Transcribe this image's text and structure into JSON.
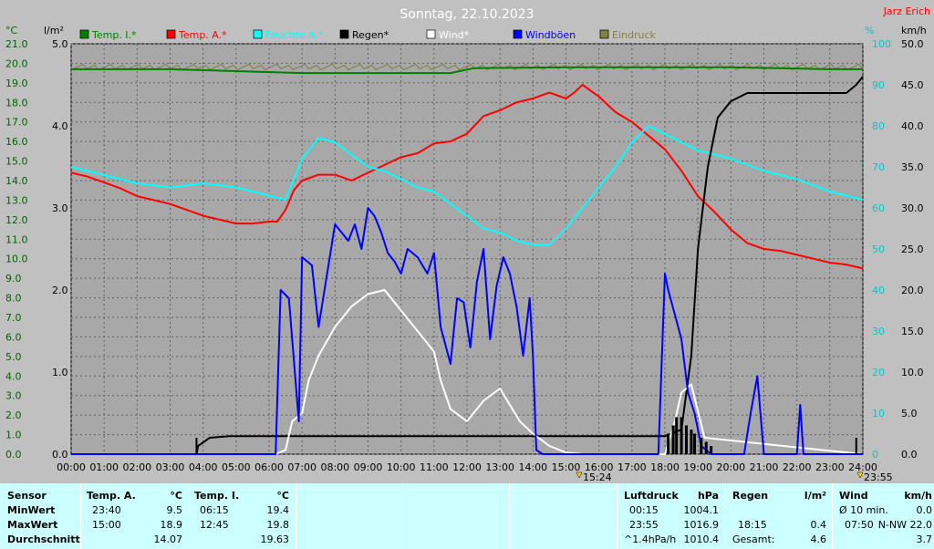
{
  "chart_data": {
    "type": "line",
    "title": "Sonntag, 22.10.2023",
    "author": "Jarz Erich",
    "left_axis_temp": {
      "unit": "°C",
      "ylim": [
        0.0,
        21.0
      ],
      "ticks": [
        "0.0",
        "1.0",
        "2.0",
        "3.0",
        "4.0",
        "5.0",
        "6.0",
        "7.0",
        "8.0",
        "9.0",
        "10.0",
        "11.0",
        "12.0",
        "13.0",
        "14.0",
        "15.0",
        "16.0",
        "17.0",
        "18.0",
        "19.0",
        "20.0",
        "21.0"
      ]
    },
    "left_axis_rain": {
      "unit": "l/m²",
      "ylim": [
        0.0,
        5.0
      ],
      "ticks": [
        "0.0",
        "1.0",
        "2.0",
        "3.0",
        "4.0",
        "5.0"
      ]
    },
    "right_axis_humidity": {
      "unit": "%",
      "ylim": [
        0,
        100
      ],
      "ticks": [
        "0",
        "10",
        "20",
        "30",
        "40",
        "50",
        "60",
        "70",
        "80",
        "90",
        "100"
      ]
    },
    "right_axis_wind": {
      "unit": "km/h",
      "ylim": [
        0.0,
        50.0
      ],
      "ticks": [
        "0.0",
        "5.0",
        "10.0",
        "15.0",
        "20.0",
        "25.0",
        "30.0",
        "35.0",
        "40.0",
        "45.0",
        "50.0"
      ]
    },
    "x_ticks": [
      "00:00",
      "01:00",
      "02:00",
      "03:00",
      "04:00",
      "05:00",
      "06:00",
      "07:00",
      "08:00",
      "09:00",
      "10:00",
      "11:00",
      "12:00",
      "13:00",
      "14:00",
      "15:00",
      "16:00",
      "17:00",
      "18:00",
      "19:00",
      "20:00",
      "21:00",
      "22:00",
      "23:00",
      "24:00"
    ],
    "x_markers": [
      "15:24",
      "23:55"
    ],
    "legend": [
      {
        "name": "Temp. I.*",
        "color": "#008000"
      },
      {
        "name": "Temp. A.*",
        "color": "#ff0000"
      },
      {
        "name": "Feuchte A.*",
        "color": "#00ffff"
      },
      {
        "name": "Regen*",
        "color": "#000000"
      },
      {
        "name": "Wind*",
        "color": "#ffffff"
      },
      {
        "name": "Windböen",
        "color": "#0000ff"
      },
      {
        "name": "Eindruck",
        "color": "#808040"
      }
    ],
    "series": [
      {
        "name": "Temp. I.*",
        "axis": "temp",
        "color": "#008000",
        "x": [
          0,
          3,
          5,
          7,
          10,
          11.5,
          12.2,
          15,
          18,
          20,
          23,
          24
        ],
        "y": [
          19.7,
          19.7,
          19.6,
          19.5,
          19.5,
          19.5,
          19.75,
          19.8,
          19.8,
          19.8,
          19.7,
          19.7
        ]
      },
      {
        "name": "Temp. A.*",
        "axis": "temp",
        "color": "#ff0000",
        "x": [
          0,
          0.5,
          1,
          1.5,
          2,
          2.5,
          3,
          3.5,
          4,
          4.5,
          5,
          5.5,
          6,
          6.25,
          6.5,
          6.75,
          7,
          7.5,
          8,
          8.5,
          9,
          9.5,
          10,
          10.5,
          11,
          11.5,
          12,
          12.5,
          13,
          13.5,
          14,
          14.5,
          15,
          15.25,
          15.5,
          16,
          16.5,
          17,
          17.5,
          18,
          18.5,
          19,
          19.5,
          20,
          20.5,
          21,
          21.5,
          22,
          22.5,
          23,
          23.5,
          24
        ],
        "y": [
          14.4,
          14.2,
          13.9,
          13.6,
          13.2,
          13.0,
          12.8,
          12.5,
          12.2,
          12.0,
          11.8,
          11.8,
          11.9,
          11.9,
          12.5,
          13.5,
          14.0,
          14.3,
          14.3,
          14.0,
          14.4,
          14.8,
          15.2,
          15.4,
          15.9,
          16.0,
          16.4,
          17.3,
          17.6,
          18.0,
          18.2,
          18.5,
          18.2,
          18.5,
          18.9,
          18.3,
          17.5,
          17.0,
          16.3,
          15.6,
          14.5,
          13.2,
          12.4,
          11.5,
          10.8,
          10.5,
          10.4,
          10.2,
          10.0,
          9.8,
          9.7,
          9.5
        ]
      },
      {
        "name": "Feuchte A.*",
        "axis": "humidity",
        "color": "#00ffff",
        "x": [
          0,
          1,
          2,
          3,
          4,
          5,
          6,
          6.5,
          7,
          7.5,
          8,
          8.5,
          9,
          9.5,
          10,
          10.5,
          11,
          11.5,
          12,
          12.5,
          13,
          13.5,
          14,
          14.5,
          15,
          15.5,
          16,
          16.5,
          17,
          17.5,
          18,
          18.5,
          19,
          20,
          21,
          22,
          23,
          24
        ],
        "y": [
          70,
          68,
          66,
          65,
          66,
          65,
          63,
          62,
          72,
          77,
          76,
          73,
          70,
          69,
          67,
          65,
          64,
          61,
          58,
          55,
          54,
          52,
          51,
          51,
          55,
          60,
          65,
          70,
          76,
          80,
          78,
          76,
          74,
          72,
          69,
          67,
          64,
          62
        ]
      },
      {
        "name": "Regen*",
        "axis": "rain",
        "color": "#000000",
        "x": [
          0,
          3.8,
          3.85,
          4.2,
          4.8,
          5.5,
          12,
          18,
          18.5,
          18.8,
          19.0,
          19.3,
          19.6,
          20,
          20.5,
          21,
          22,
          23,
          23.5,
          23.8,
          24
        ],
        "y": [
          0.0,
          0.0,
          0.1,
          0.2,
          0.22,
          0.22,
          0.22,
          0.22,
          0.3,
          1.2,
          2.5,
          3.5,
          4.1,
          4.3,
          4.4,
          4.4,
          4.4,
          4.4,
          4.4,
          4.5,
          4.6
        ]
      },
      {
        "name": "Wind*",
        "axis": "wind",
        "color": "#ffffff",
        "x": [
          0,
          6.2,
          6.5,
          6.7,
          7,
          7.2,
          7.5,
          8,
          8.5,
          9,
          9.5,
          10,
          10.5,
          11,
          11.2,
          11.5,
          12,
          12.5,
          13,
          13.3,
          13.6,
          14,
          14.5,
          15,
          15.5,
          18,
          18.3,
          18.5,
          18.8,
          19.2,
          24
        ],
        "y": [
          0,
          0,
          0.5,
          4.0,
          5.0,
          9.0,
          12.0,
          15.5,
          18.0,
          19.5,
          20.0,
          17.5,
          15.0,
          12.5,
          9.0,
          5.5,
          4.0,
          6.5,
          8.0,
          6.0,
          4.0,
          2.5,
          1.0,
          0.2,
          0,
          0,
          4.0,
          7.5,
          8.5,
          2.0,
          0
        ]
      },
      {
        "name": "Windböen",
        "axis": "wind",
        "color": "#0000ff",
        "x": [
          0,
          6.2,
          6.35,
          6.6,
          6.9,
          7.0,
          7.3,
          7.5,
          7.8,
          8.0,
          8.2,
          8.4,
          8.6,
          8.8,
          9.0,
          9.2,
          9.4,
          9.6,
          9.8,
          10.0,
          10.2,
          10.5,
          10.8,
          11.0,
          11.2,
          11.5,
          11.7,
          11.9,
          12.1,
          12.3,
          12.5,
          12.7,
          12.9,
          13.1,
          13.3,
          13.5,
          13.7,
          13.9,
          14.0,
          14.1,
          14.3,
          15.0,
          17.8,
          18.0,
          18.1,
          18.3,
          18.5,
          18.7,
          18.9,
          19.1,
          19.4,
          19.6,
          20.0,
          20.4,
          20.6,
          20.8,
          21.0,
          21.8,
          22.0,
          22.1,
          22.2,
          24
        ],
        "y": [
          0,
          0,
          20.0,
          19.0,
          4.0,
          24.0,
          23.0,
          15.5,
          23.0,
          28.0,
          27.0,
          26.0,
          28.0,
          25.0,
          30.0,
          29.0,
          27.0,
          24.5,
          23.5,
          22.0,
          25.0,
          24.0,
          22.0,
          24.5,
          15.5,
          11.0,
          19.0,
          18.5,
          13.0,
          21.0,
          25.0,
          14.0,
          20.5,
          24.0,
          22.0,
          18.0,
          12.0,
          19.0,
          12.0,
          0.5,
          0,
          0,
          0,
          22.0,
          20.0,
          17.0,
          14.0,
          7.5,
          5.0,
          1.0,
          0,
          0,
          0,
          0,
          5.0,
          9.5,
          0,
          0,
          0,
          6.0,
          0,
          0
        ]
      }
    ]
  },
  "stats": {
    "sensor": {
      "title": "Sensor",
      "min": "MinWert",
      "max": "MaxWert",
      "avg": "Durchschnitt"
    },
    "temp_a": {
      "title": "Temp. A.",
      "unit": "°C",
      "min_time": "23:40",
      "min_val": "9.5",
      "max_time": "15:00",
      "max_val": "18.9",
      "avg_val": "14.07"
    },
    "temp_i": {
      "title": "Temp. I.",
      "unit": "°C",
      "min_time": "06:15",
      "min_val": "19.4",
      "max_time": "12:45",
      "max_val": "19.8",
      "avg_val": "19.63"
    },
    "pressure": {
      "title": "Luftdruck",
      "unit": "hPa",
      "min_time": "00:15",
      "min_val": "1004.1",
      "max_time": "23:55",
      "max_val": "1016.9",
      "trend_label": "^1.4hPa/h",
      "trend_val": "1010.4"
    },
    "rain": {
      "title": "Regen",
      "unit": "l/m²",
      "max_time": "18:15",
      "max_val": "0.4",
      "total_label": "Gesamt:",
      "total_val": "4.6"
    },
    "wind": {
      "title": "Wind",
      "unit": "km/h",
      "avg_label": "Ø 10 min.",
      "avg_val": "0.0",
      "max_time": "07:50",
      "max_val": "N-NW 22.0",
      "day_val": "3.7"
    }
  }
}
